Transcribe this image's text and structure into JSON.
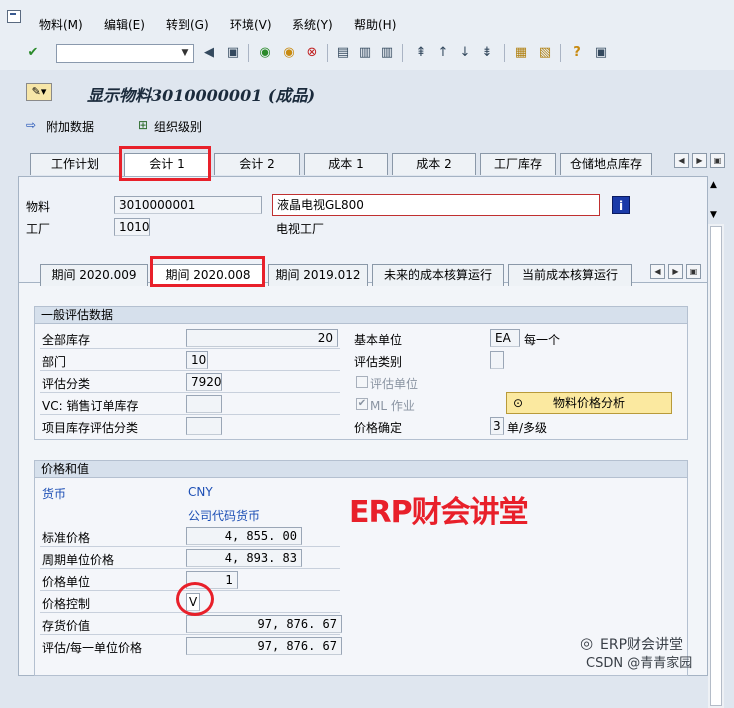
{
  "menu": [
    "物料(M)",
    "编辑(E)",
    "转到(G)",
    "环境(V)",
    "系统(Y)",
    "帮助(H)"
  ],
  "title": "显示物料3010000001 (成品)",
  "appbar": {
    "attach": "附加数据",
    "org": "组织级别"
  },
  "tabs": [
    "工作计划",
    "会计 1",
    "会计 2",
    "成本 1",
    "成本 2",
    "工厂库存",
    "仓储地点库存"
  ],
  "header": {
    "material_label": "物料",
    "material_value": "3010000001",
    "material_desc": "液晶电视GL800",
    "plant_label": "工厂",
    "plant_value": "1010",
    "plant_desc": "电视工厂"
  },
  "period_tabs": [
    "期间 2020.009",
    "期间 2020.008",
    "期间 2019.012",
    "未来的成本核算运行",
    "当前成本核算运行"
  ],
  "general": {
    "heading": "一般评估数据",
    "total_stock_label": "全部库存",
    "total_stock": "20",
    "division_label": "部门",
    "division": "10",
    "valuation_class_label": "评估分类",
    "valuation_class": "7920",
    "vc_label": "VC: 销售订单库存",
    "project_label": "项目库存评估分类",
    "base_unit_label": "基本单位",
    "base_unit": "EA",
    "base_unit_desc": "每一个",
    "valuation_cat_label": "评估类别",
    "valuated_unit_label": "评估单位",
    "ml_label": "ML 作业",
    "price_analysis": "物料价格分析",
    "price_det_label": "价格确定",
    "price_det": "3",
    "price_det_desc": "单/多级"
  },
  "prices": {
    "heading": "价格和值",
    "currency_label": "货币",
    "currency": "CNY",
    "currency_desc": "公司代码货币",
    "std_price_label": "标准价格",
    "std_price": "4, 855. 00",
    "period_price_label": "周期单位价格",
    "period_price": "4, 893. 83",
    "price_unit_label": "价格单位",
    "price_unit": "1",
    "price_ctrl_label": "价格控制",
    "price_ctrl": "V",
    "stock_value_label": "存货价值",
    "stock_value": "97, 876. 67",
    "val_per_unit_label": "评估/每一单位价格",
    "val_per_unit": "97, 876. 67"
  },
  "watermark": "ERP财会讲堂",
  "wechat": "ERP财会讲堂",
  "csdn": "CSDN @青青家园"
}
